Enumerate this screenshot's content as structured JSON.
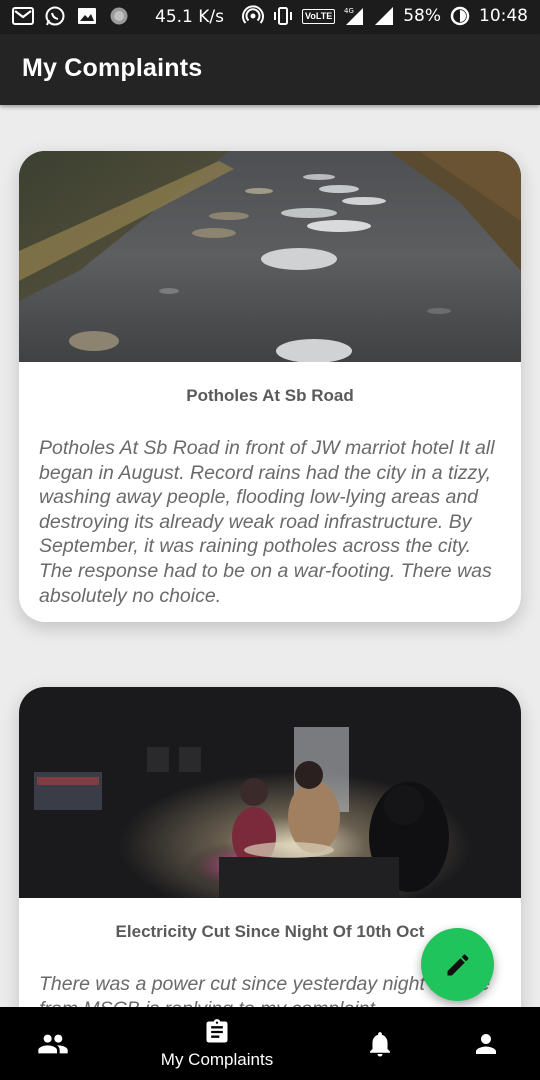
{
  "status_bar": {
    "speed": "45.1 K/s",
    "volte": "VoLTE",
    "network": "4G",
    "battery": "58%",
    "time": "10:48",
    "icons": [
      "gmail-icon",
      "whatsapp-icon",
      "gallery-icon",
      "sync-icon",
      "hotspot-icon",
      "vibrate-icon",
      "signal-icon",
      "signal-icon",
      "battery-saver-icon"
    ]
  },
  "app_bar": {
    "title": "My Complaints"
  },
  "complaints": [
    {
      "title": "Potholes At Sb Road",
      "description": "Potholes At Sb Road in front of JW marriot hotel It all began in August. Record rains had the city in a tizzy, washing away people, flooding low-lying areas and destroying its already weak road infrastructure. By September, it was raining potholes across the city. The response had to be on a war-footing. There was absolutely no choice."
    },
    {
      "title": "Electricity Cut Since Night Of 10th Oct",
      "description": "There was a power cut since yesterday night no one from MSCB is replying to my complaint"
    }
  ],
  "fab": {
    "icon": "edit-pencil-icon",
    "color": "#1fc45c"
  },
  "bottom_nav": {
    "items": [
      {
        "icon": "people-icon",
        "label": ""
      },
      {
        "icon": "clipboard-icon",
        "label": "My Complaints"
      },
      {
        "icon": "bell-icon",
        "label": ""
      },
      {
        "icon": "user-icon",
        "label": ""
      }
    ]
  },
  "colors": {
    "app_bar": "#242424",
    "status_bar": "#1c1c1c",
    "background": "#ececec",
    "accent": "#1fc45c"
  }
}
